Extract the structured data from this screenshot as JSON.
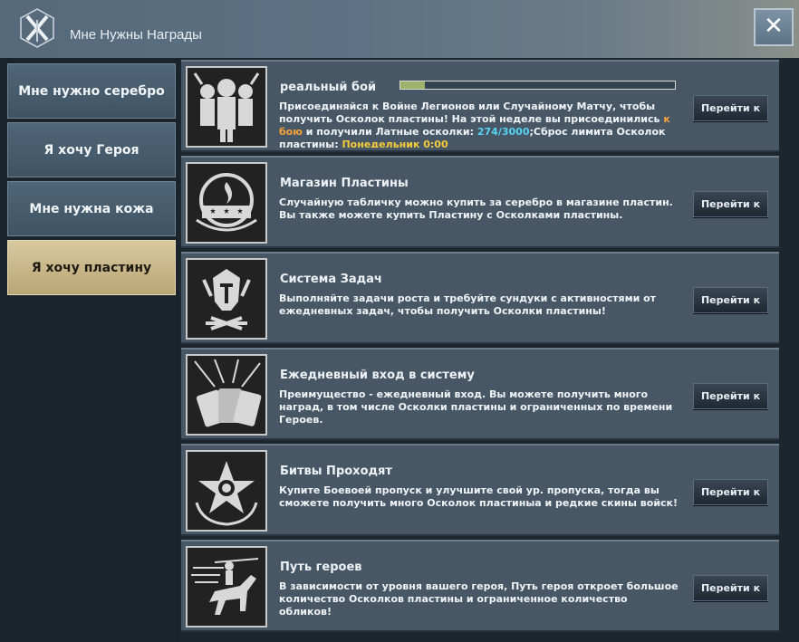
{
  "header": {
    "title": "Мне Нужны Награды",
    "close_label": "✕"
  },
  "sidebar": {
    "items": [
      {
        "label": "Мне нужно серебро"
      },
      {
        "label": "Я хочу Героя"
      },
      {
        "label": "Мне нужна кожа"
      },
      {
        "label": "Я хочу пластину",
        "active": true
      }
    ]
  },
  "rows": [
    {
      "title": "реальный бой",
      "icon": "knights-battle-icon",
      "progress": 0.09,
      "desc_parts": [
        "Присоединяйся к Войне Легионов или Случайному Матчу, чтобы получить Осколок пластины! На этой неделе вы присоединились ",
        "к бою",
        " и получили Латные осколки: ",
        "274/3000",
        ";Сброс лимита Осколок пластины: ",
        "Понедельник 0:00"
      ],
      "button": "Перейти к"
    },
    {
      "title": "Магазин Пластины",
      "icon": "shop-emblem-icon",
      "desc": "Случайную табличку можно купить за серебро в магазине пластин. Вы также можете купить Пластину с Осколками пластины.",
      "button": "Перейти к"
    },
    {
      "title": "Система Задач",
      "icon": "spartan-helmet-icon",
      "desc": "Выполняйте задачи роста и требуйте сундуки с активностями от ежедневных задач, чтобы получить Осколки пластины!",
      "button": "Перейти к"
    },
    {
      "title": "Ежедневный вход в систему",
      "icon": "cards-icon",
      "desc": "Преимущество - ежедневный вход. Вы можете получить много наград, в том числе Осколки пластины и ограниченных по времени Героев.",
      "button": "Перейти к"
    },
    {
      "title": "Битвы Проходят",
      "icon": "star-medal-icon",
      "desc": "Купите Боевоей пропуск и улучшите свой ур. пропуска, тогда вы сможете получить много Осколок пластиныа и редкие скины войск!",
      "button": "Перейти к"
    },
    {
      "title": "Путь героев",
      "icon": "horse-rider-icon",
      "desc": "В зависимости от уровня вашего героя, Путь героя откроет большое количество Осколков пластины и ограниченное количество обликов!",
      "button": "Перейти к"
    }
  ]
}
